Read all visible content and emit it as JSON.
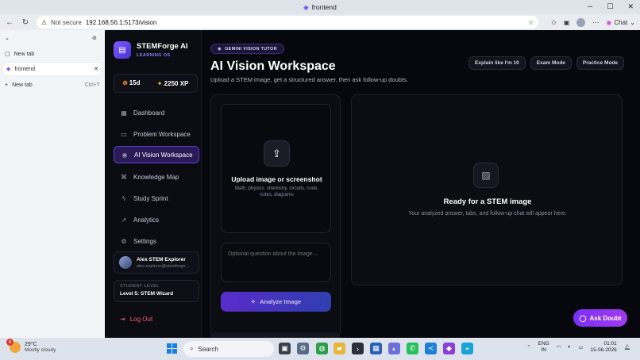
{
  "browser": {
    "window_title": "frontend",
    "not_secure": "Not secure",
    "url": "192.168.56.1:5173/vision",
    "chat_label": "Chat"
  },
  "tabs_panel": {
    "items": [
      {
        "label": "New tab"
      },
      {
        "label": "frontend"
      },
      {
        "label": "New tab",
        "shortcut": "Ctrl+T"
      }
    ]
  },
  "sidebar": {
    "brand_name": "STEMForge AI",
    "brand_sub": "LEARNING OS",
    "streak": "15d",
    "xp": "2250 XP",
    "nav": [
      {
        "label": "Dashboard",
        "icon": "grid-icon"
      },
      {
        "label": "Problem Workspace",
        "icon": "document-icon"
      },
      {
        "label": "AI Vision Workspace",
        "icon": "eye-icon"
      },
      {
        "label": "Knowledge Map",
        "icon": "network-icon"
      },
      {
        "label": "Study Sprint",
        "icon": "lightning-icon"
      },
      {
        "label": "Analytics",
        "icon": "chart-icon"
      },
      {
        "label": "Settings",
        "icon": "gear-icon"
      }
    ],
    "user_name": "Alex STEM Explorer",
    "user_email": "alex.explorer@stemforge...",
    "level_label": "STUDENT LEVEL",
    "level_value": "Level 5: STEM Wizard",
    "logout": "Log Out"
  },
  "main": {
    "badge": "GEMINI VISION TUTOR",
    "title": "AI Vision Workspace",
    "subtitle": "Upload a STEM image, get a structured answer, then ask follow-up doubts.",
    "modes": [
      "Explain like I'm 10",
      "Exam Mode",
      "Practice Mode"
    ],
    "upload_title": "Upload image or screenshot",
    "upload_desc": "Math, physics, chemistry, circuits, code, notes, diagrams",
    "question_placeholder": "Optional question about the image...",
    "analyze_label": "Analyze Image",
    "ready_title": "Ready for a STEM image",
    "ready_desc": "Your analyzed answer, tabs, and follow-up chat will appear here.",
    "ask_doubt": "Ask Doubt"
  },
  "taskbar": {
    "temp": "29°C",
    "weather": "Mostly cloudy",
    "weather_badge": "4",
    "search": "Search",
    "lang1": "ENG",
    "lang2": "IN",
    "time": "01:01",
    "date": "15-06-2026"
  }
}
